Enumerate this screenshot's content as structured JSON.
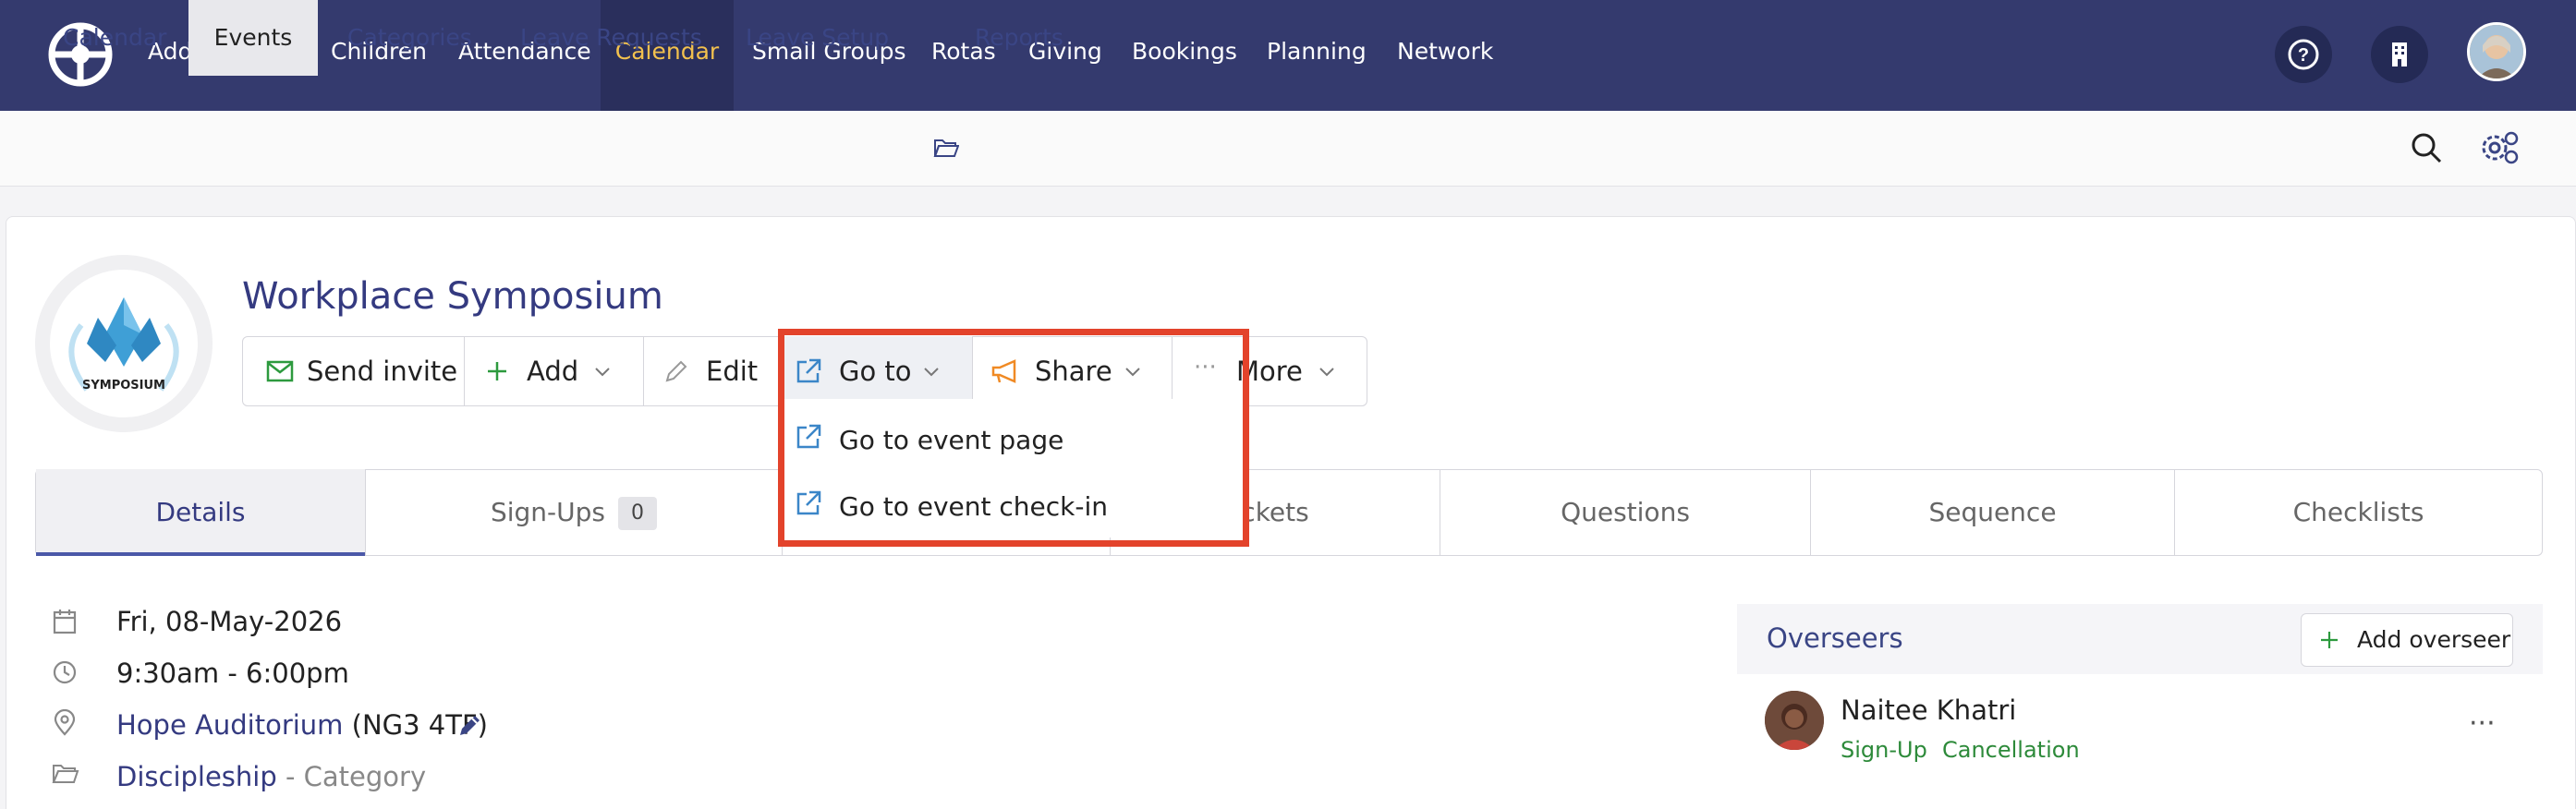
{
  "top_nav": {
    "items": [
      "Address Book",
      "Children",
      "Attendance",
      "Calendar",
      "Small Groups",
      "Rotas",
      "Giving",
      "Bookings",
      "Planning",
      "Network"
    ],
    "active": "Calendar",
    "icons": [
      "help-icon",
      "building-icon",
      "user-avatar"
    ]
  },
  "sub_nav": {
    "items": [
      "Calendar",
      "Events",
      "Categories",
      "Leave Requests",
      "Leave Setup",
      "Reports"
    ],
    "active": "Events",
    "icons": [
      "search-icon",
      "settings-icon"
    ]
  },
  "event": {
    "logo_text": "SYMPOSIUM",
    "title": "Workplace Symposium",
    "actions": {
      "send_invite": "Send invite",
      "add": "Add",
      "edit": "Edit",
      "go_to": "Go to",
      "share": "Share",
      "more": "More"
    },
    "go_to_menu": [
      "Go to event page",
      "Go to event check-in"
    ],
    "tabs": [
      {
        "label": "Details"
      },
      {
        "label": "Sign-Ups",
        "badge": "0"
      },
      {
        "label": ""
      },
      {
        "label": "ckets"
      },
      {
        "label": "Questions"
      },
      {
        "label": "Sequence"
      },
      {
        "label": "Checklists"
      }
    ],
    "details": {
      "date": "Fri, 08-May-2026",
      "time": "9:30am - 6:00pm",
      "location_name": "Hope Auditorium",
      "location_postcode": "(NG3 4TF)",
      "category": "Discipleship",
      "category_suffix": "- Category"
    }
  },
  "overseers": {
    "title": "Overseers",
    "add_label": "Add overseer",
    "people": [
      {
        "name": "Naitee Khatri",
        "tags": [
          "Sign-Up",
          "Cancellation"
        ]
      }
    ]
  },
  "colors": {
    "nav_bg": "#343a6e",
    "nav_active_text": "#f2c14e",
    "link": "#343a80",
    "highlight": "#e3432b",
    "green": "#2d8a3a"
  }
}
